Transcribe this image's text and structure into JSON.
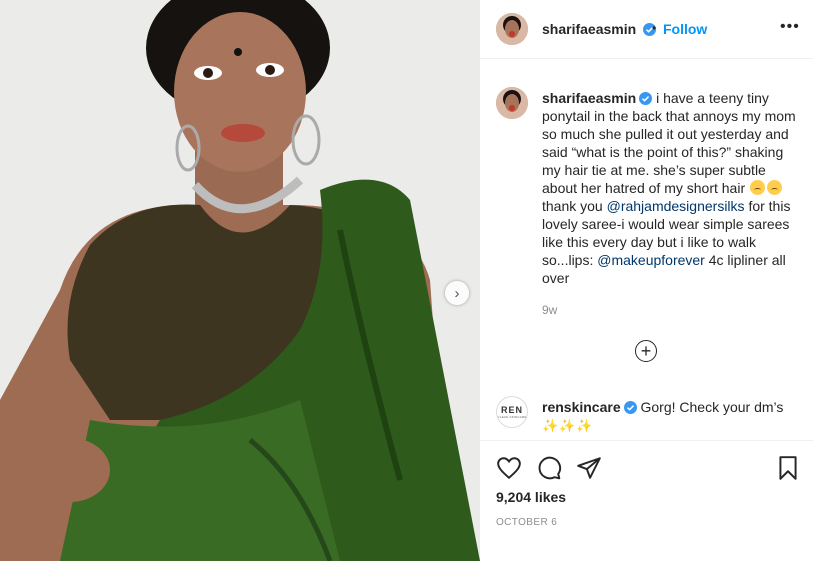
{
  "post": {
    "username": "sharifaeasmin",
    "separator": "•",
    "follow_label": "Follow",
    "more_label": "•••",
    "next_label": "›",
    "caption": {
      "username": "sharifaeasmin",
      "text_1": "i have a teeny tiny ponytail in the back that annoys my mom so much she pulled it out yesterday and said “what is the point of this?” shaking my hair tie at me. she’s super subtle about her hatred of my short hair",
      "text_2": "thank you",
      "mention_1": "@rahjamdesignersilks",
      "text_3": "for this lovely saree-i would wear simple sarees like this every day but i like to walk so...lips:",
      "mention_2": "@makeupforever",
      "text_4": "4c lipliner all over",
      "age": "9w"
    },
    "load_more_label": "+",
    "comment": {
      "avatar_text": "REN",
      "avatar_sub": "CLEAN SKINCARE",
      "username": "renskincare",
      "text": "Gorg! Check your dm’s",
      "emoji": "✨✨✨"
    },
    "likes": "9,204 likes",
    "date": "OCTOBER 6",
    "colors": {
      "follow": "#0095f6",
      "verified": "#3897f0",
      "saree": "#2e5a1c",
      "blouse": "#3d3520"
    }
  }
}
